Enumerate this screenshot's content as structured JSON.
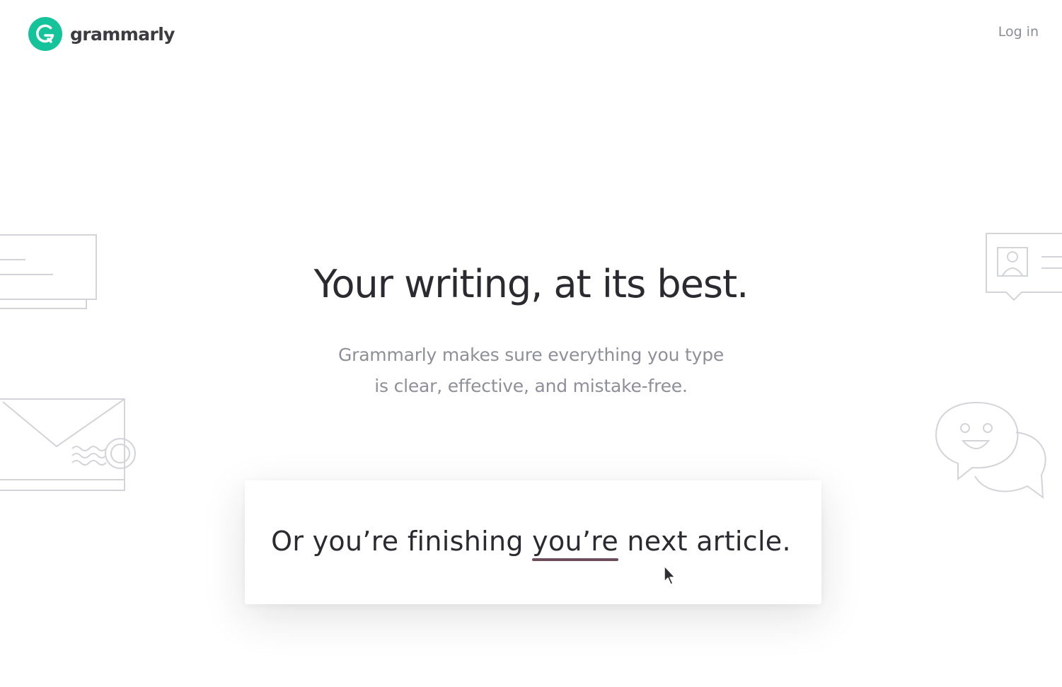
{
  "header": {
    "brand": "grammarly",
    "login_label": "Log in"
  },
  "hero": {
    "title": "Your writing, at its best.",
    "subtitle_line1": "Grammarly makes sure everything you type",
    "subtitle_line2": "is clear, effective, and mistake-free."
  },
  "demo": {
    "text_before": "Or you’re finishing ",
    "flagged_word": "you’re",
    "text_after": " next article."
  },
  "icons": {
    "logo": "grammarly-g-logo-icon",
    "document": "document-icon",
    "profile_card": "profile-card-icon",
    "envelope": "envelope-icon",
    "chat": "chat-bubbles-icon",
    "cursor": "mouse-pointer-icon"
  },
  "colors": {
    "brand_green": "#15c39a",
    "underline": "#6f4c5b",
    "text_dark": "#2b2a30",
    "text_muted": "#8e8f99"
  }
}
